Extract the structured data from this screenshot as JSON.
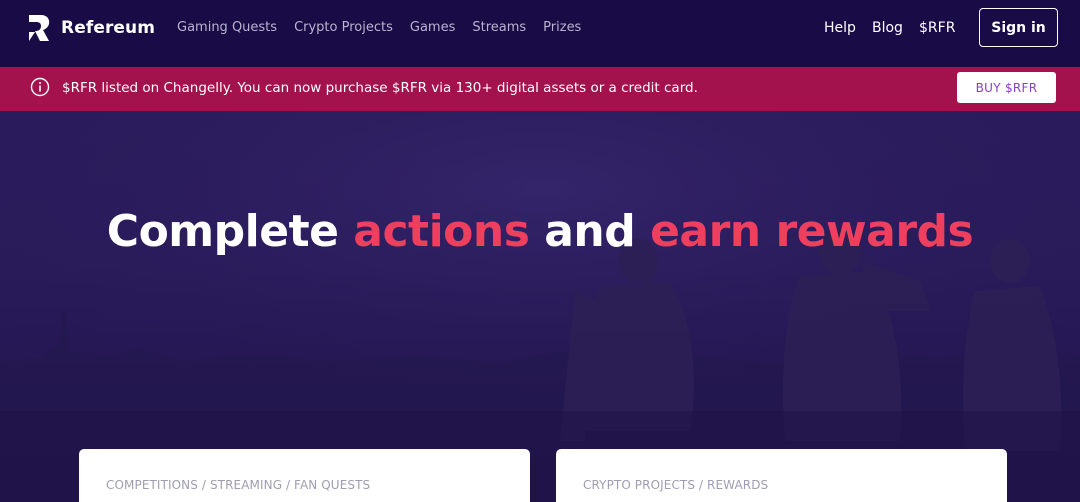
{
  "brand": {
    "name": "Refereum"
  },
  "nav": {
    "items": [
      "Gaming Quests",
      "Crypto Projects",
      "Games",
      "Streams",
      "Prizes"
    ]
  },
  "right_nav": {
    "help": "Help",
    "blog": "Blog",
    "token": "$RFR",
    "signin": "Sign in"
  },
  "announcement": {
    "text": "$RFR listed on Changelly. You can now purchase $RFR via 130+ digital assets or a credit card.",
    "button": "BUY $RFR"
  },
  "hero": {
    "title_part1": "Complete ",
    "title_accent1": "actions",
    "title_part2": " and ",
    "title_accent2": "earn rewards"
  },
  "cards": [
    {
      "label": "COMPETITIONS / STREAMING / FAN QUESTS"
    },
    {
      "label": "CRYPTO PROJECTS / REWARDS"
    }
  ],
  "colors": {
    "header_bg": "#190b45",
    "announce_bg": "#a3124d",
    "accent": "#ee3f5e",
    "buy_text": "#8a3ec8"
  },
  "icons": {
    "logo": "refereum-logo-icon",
    "info": "info-icon"
  }
}
